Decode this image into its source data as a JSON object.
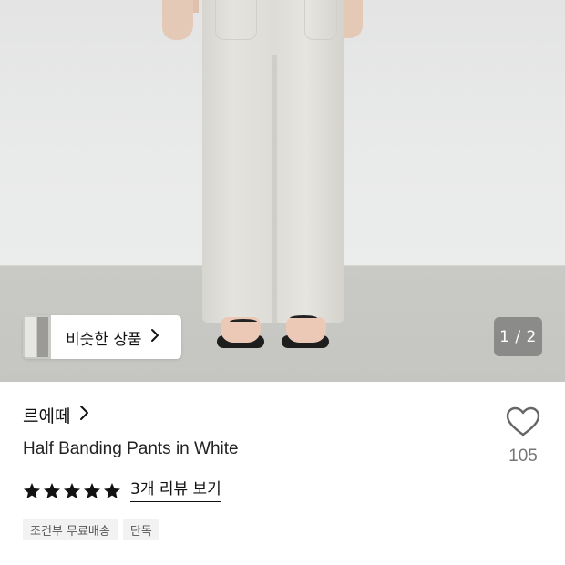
{
  "gallery": {
    "page_indicator": "1 / 2",
    "current_page": 1,
    "total_pages": 2
  },
  "similar_products": {
    "label": "비슷한 상품",
    "chevron": "›"
  },
  "product": {
    "brand": "르에떼",
    "brand_chevron": "›",
    "name": "Half Banding Pants in White",
    "like_count": "105",
    "rating": 5,
    "review_link": "3개 리뷰 보기",
    "tags": [
      "조건부 무료배송",
      "단독"
    ]
  },
  "colors": {
    "star": "#111111",
    "heart_outline": "#666666"
  },
  "icons": {
    "like": "heart-outline-icon",
    "star": "star-filled-icon",
    "chevron": "chevron-right-icon"
  }
}
